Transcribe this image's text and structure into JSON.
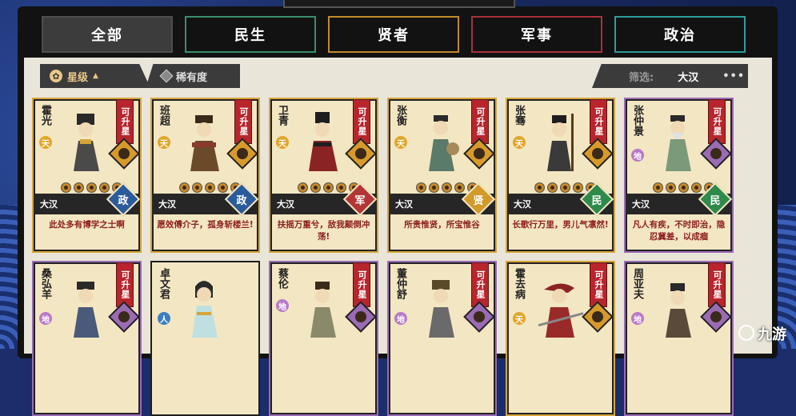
{
  "tabs": [
    {
      "label": "全部",
      "active": true
    },
    {
      "label": "民生"
    },
    {
      "label": "贤者"
    },
    {
      "label": "军事"
    },
    {
      "label": "政治"
    }
  ],
  "sort": {
    "star_label": "星级",
    "star_arrow": "▲",
    "rarity_label": "稀有度"
  },
  "filter": {
    "label": "筛选:",
    "value": "大汉",
    "more": "•••"
  },
  "cards_row1": [
    {
      "name": "霍光",
      "grade": "天",
      "upgrade": "可升星",
      "region": "大汉",
      "role": "政",
      "quote": "此处多有博学之士啊"
    },
    {
      "name": "班超",
      "grade": "天",
      "upgrade": "可升星",
      "region": "大汉",
      "role": "政",
      "quote": "愿效傅介子，孤身斩楼兰!"
    },
    {
      "name": "卫青",
      "grade": "天",
      "upgrade": "可升星",
      "region": "大汉",
      "role": "军",
      "quote": "扶摇万重兮，敌我颠倒冲荡!"
    },
    {
      "name": "张衡",
      "grade": "天",
      "upgrade": "可升星",
      "region": "大汉",
      "role": "贤",
      "quote": "所贵惟贤，所宝惟谷"
    },
    {
      "name": "张骞",
      "grade": "天",
      "upgrade": "可升星",
      "region": "大汉",
      "role": "民",
      "quote": "长歌行万里，男儿气凛然!"
    },
    {
      "name": "张仲景",
      "grade": "地",
      "upgrade": "可升星",
      "region": "大汉",
      "role": "民",
      "quote": "凡人有疾，不时即治，隐忍冀差，以成痼"
    }
  ],
  "cards_row2": [
    {
      "name": "桑弘羊",
      "grade": "地",
      "upgrade": "可升星"
    },
    {
      "name": "卓文君",
      "grade": "人",
      "upgrade": ""
    },
    {
      "name": "蔡伦",
      "grade": "地",
      "upgrade": "可升星"
    },
    {
      "name": "董仲舒",
      "grade": "地",
      "upgrade": "可升星"
    },
    {
      "name": "霍去病",
      "grade": "天",
      "upgrade": "可升星"
    },
    {
      "name": "周亚夫",
      "grade": "地",
      "upgrade": "可升星"
    }
  ],
  "watermark": "九游"
}
